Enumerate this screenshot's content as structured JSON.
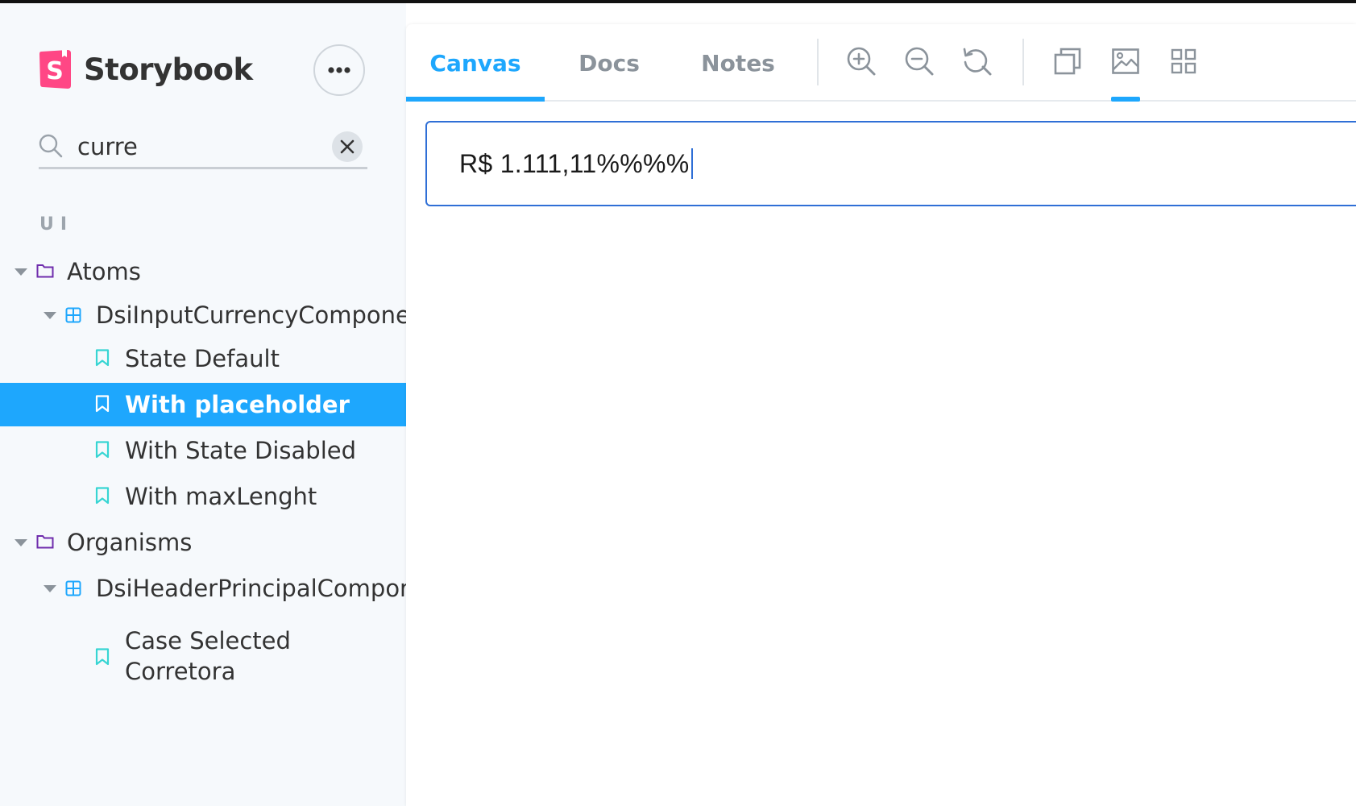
{
  "sidebar": {
    "brand": {
      "name": "Storybook",
      "logo_letter": "S"
    },
    "more_button": {
      "icon": "ellipsis-icon"
    },
    "search": {
      "value": "curre",
      "clear_icon": "close-icon"
    },
    "section_label": "UI",
    "tree": [
      {
        "label": "Atoms",
        "kind": "folder",
        "depth": 0,
        "expanded": true
      },
      {
        "label": "DsiInputCurrencyComponent",
        "kind": "component",
        "depth": 1,
        "expanded": true
      },
      {
        "label": "State Default",
        "kind": "story",
        "depth": 2
      },
      {
        "label": "With placeholder",
        "kind": "story",
        "depth": 2,
        "selected": true
      },
      {
        "label": "With State Disabled",
        "kind": "story",
        "depth": 2
      },
      {
        "label": "With maxLenght",
        "kind": "story",
        "depth": 2
      },
      {
        "label": "Organisms",
        "kind": "folder",
        "depth": 0,
        "expanded": true
      },
      {
        "label": "DsiHeaderPrincipalComponent",
        "kind": "component",
        "depth": 1,
        "expanded": true
      },
      {
        "label": "Case Selected Corretora",
        "kind": "story",
        "depth": 2
      }
    ]
  },
  "toolbar": {
    "tabs": [
      {
        "label": "Canvas",
        "active": true
      },
      {
        "label": "Docs",
        "active": false
      },
      {
        "label": "Notes",
        "active": false
      }
    ],
    "tools": [
      {
        "icon": "zoom-in-icon"
      },
      {
        "icon": "zoom-out-icon"
      },
      {
        "icon": "reset-zoom-icon"
      },
      {
        "icon": "copy-icon"
      },
      {
        "icon": "image-icon",
        "active": true
      },
      {
        "icon": "grid-icon"
      }
    ]
  },
  "preview": {
    "currency_input": {
      "value": "R$ 1.111,11%%%%"
    }
  },
  "colors": {
    "accent": "#1ea7fd",
    "brand": "#ff4785",
    "folder": "#6f2cac",
    "component": "#1ea7fd",
    "story": "#37d5d3",
    "input_border": "#2f6fd6"
  }
}
